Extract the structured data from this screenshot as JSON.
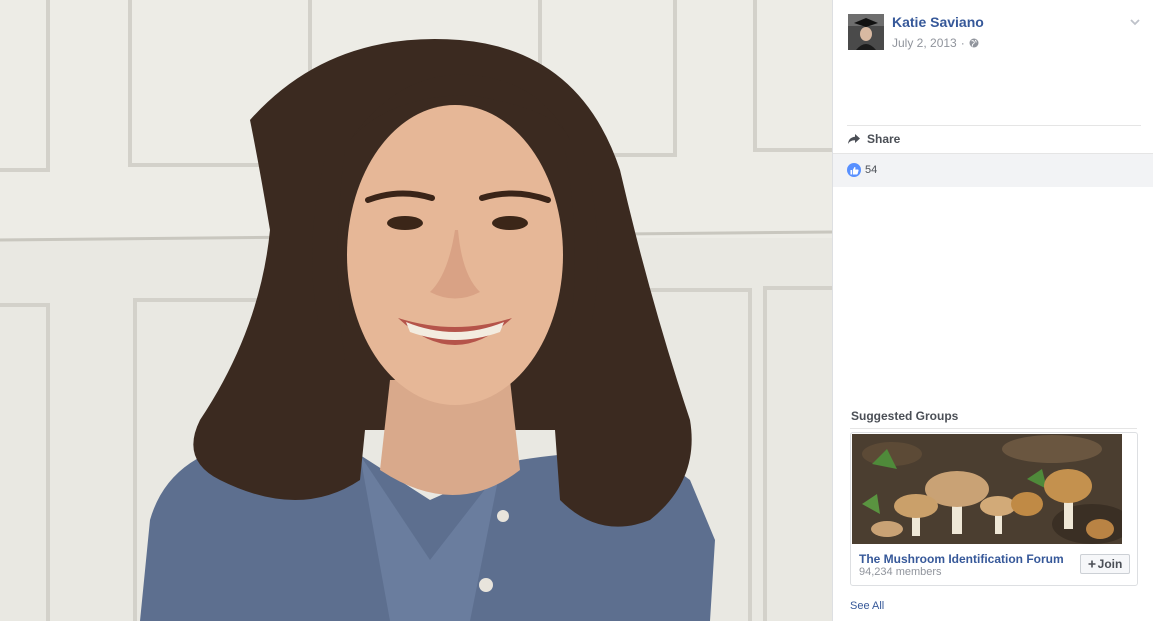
{
  "post": {
    "author": "Katie Saviano",
    "date": "July 2, 2013",
    "date_separator": "·",
    "privacy_icon": "globe-icon",
    "menu_icon": "chevron-down-icon"
  },
  "actions": {
    "share_label": "Share",
    "share_icon": "share-arrow-icon"
  },
  "reactions": {
    "like_icon": "thumbs-up-icon",
    "count": "54"
  },
  "suggested_groups": {
    "title": "Suggested Groups",
    "groups": [
      {
        "name": "The Mushroom Identification Forum",
        "members": "94,234 members",
        "join_label": "Join",
        "join_icon": "plus-icon"
      }
    ],
    "see_all_label": "See All"
  },
  "colors": {
    "link_blue": "#365899",
    "like_blue": "#5890ff",
    "muted_gray": "#90949c",
    "text_dark": "#4b4f56"
  }
}
